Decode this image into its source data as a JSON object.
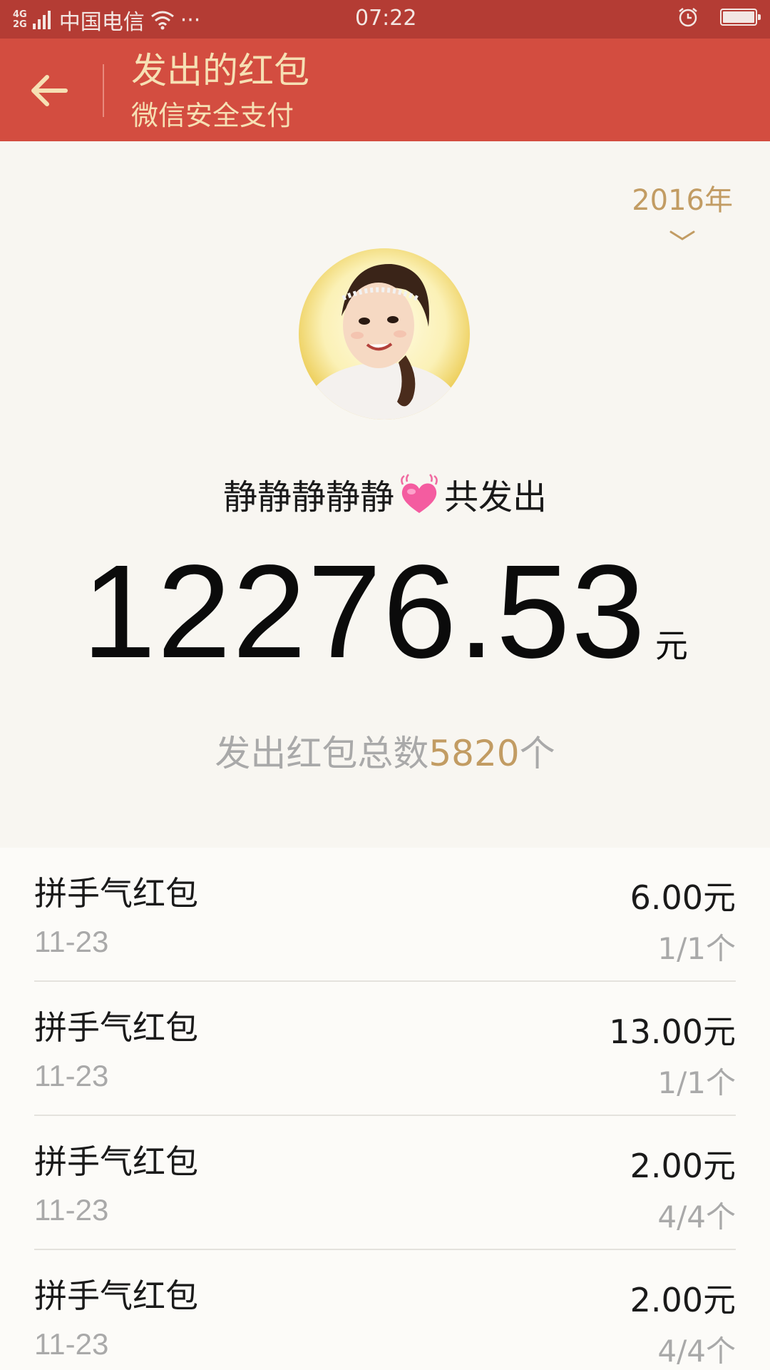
{
  "status_bar": {
    "network_top": "4G",
    "network_bottom": "2G",
    "carrier": "中国电信",
    "more": "···",
    "time": "07:22"
  },
  "header": {
    "title": "发出的红包",
    "subtitle": "微信安全支付"
  },
  "summary": {
    "year": "2016年",
    "sender_name": "静静静静静",
    "sender_suffix": "共发出",
    "total_amount": "12276.53",
    "amount_unit": "元",
    "count_prefix": "发出红包总数",
    "count_value": "5820",
    "count_suffix": "个"
  },
  "colors": {
    "header_bg": "#d34d40",
    "status_bg": "#b43c34",
    "accent_gold": "#c29c63",
    "page_bg": "#f8f6f1"
  },
  "list": {
    "items": [
      {
        "name": "拼手气红包",
        "date": "11-23",
        "amount": "6.00元",
        "count": "1/1个"
      },
      {
        "name": "拼手气红包",
        "date": "11-23",
        "amount": "13.00元",
        "count": "1/1个"
      },
      {
        "name": "拼手气红包",
        "date": "11-23",
        "amount": "2.00元",
        "count": "4/4个"
      },
      {
        "name": "拼手气红包",
        "date": "11-23",
        "amount": "2.00元",
        "count": "4/4个"
      }
    ]
  }
}
